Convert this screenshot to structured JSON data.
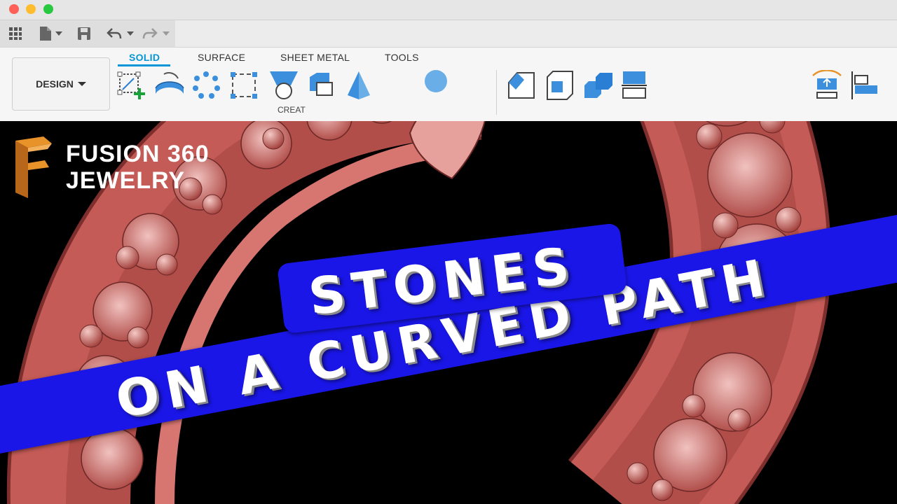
{
  "window": {
    "traffic_lights": [
      {
        "name": "close",
        "color": "#fe5f57"
      },
      {
        "name": "minimize",
        "color": "#febc2e"
      },
      {
        "name": "zoom",
        "color": "#28c840"
      }
    ]
  },
  "quick_access": {
    "icons": [
      "app-grid-icon",
      "file-icon",
      "chevron-down-icon",
      "save-icon",
      "undo-icon",
      "chevron-down-icon",
      "redo-icon",
      "chevron-down-icon"
    ]
  },
  "workspace": {
    "label": "DESIGN"
  },
  "tabs": [
    {
      "label": "SOLID",
      "active": true
    },
    {
      "label": "SURFACE",
      "active": false
    },
    {
      "label": "SHEET METAL",
      "active": false
    },
    {
      "label": "TOOLS",
      "active": false
    }
  ],
  "toolbar": {
    "panel_label": "CREAT",
    "tools": [
      "create-sketch-icon",
      "extrude-icon",
      "pattern-icon",
      "bounding-box-icon",
      "loft-icon",
      "box-icon",
      "cone-icon",
      "sphere-icon",
      "chamfer-icon",
      "shell-icon",
      "combine-icon",
      "split-body-icon",
      "offset-plane-icon",
      "align-icon"
    ]
  },
  "brand": {
    "line1": "FUSION 360",
    "line2": "JEWELRY",
    "logo_color": "#e8922a"
  },
  "banner": {
    "line1": "STONES",
    "line2": "ON A CURVED PATH",
    "color": "#1a16e8"
  },
  "model": {
    "color": "#c25a56"
  }
}
